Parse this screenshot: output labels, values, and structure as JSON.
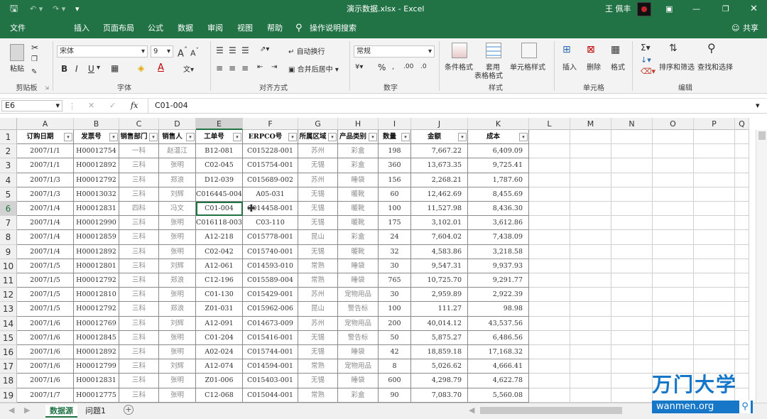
{
  "window": {
    "title": "演示数据.xlsx  -  Excel",
    "user": "王 佩丰"
  },
  "ribbon_tabs": [
    "文件",
    "插入",
    "页面布局",
    "公式",
    "数据",
    "审阅",
    "视图",
    "帮助"
  ],
  "tell_me": "操作说明搜索",
  "share": "共享",
  "font": {
    "name": "宋体",
    "size": "9",
    "bold": "B",
    "italic": "I",
    "underline": "U",
    "grow": "A",
    "shrink": "A"
  },
  "clipboard": {
    "paste": "粘贴"
  },
  "alignment": {
    "wrap": "自动换行",
    "merge": "合并后居中"
  },
  "number": {
    "format": "常规",
    "percent": "%"
  },
  "styles": {
    "cond": "条件格式",
    "table1": "套用",
    "table2": "表格格式",
    "cell": "单元格样式"
  },
  "cells": {
    "insert": "插入",
    "delete": "删除",
    "format": "格式"
  },
  "editing": {
    "sort": "排序和筛选",
    "find": "查找和选择"
  },
  "group_labels": {
    "clipboard": "剪贴板",
    "font": "字体",
    "alignment": "对齐方式",
    "number": "数字",
    "styles": "样式",
    "cells": "单元格",
    "editing": "编辑"
  },
  "name_box": "E6",
  "formula_value": "C01-004",
  "fx": "fx",
  "columns": [
    "A",
    "B",
    "C",
    "D",
    "E",
    "F",
    "G",
    "H",
    "I",
    "J",
    "K",
    "L",
    "M",
    "N",
    "O",
    "P",
    "Q"
  ],
  "row_numbers": [
    "1",
    "2",
    "3",
    "4",
    "5",
    "6",
    "7",
    "8",
    "9",
    "10",
    "11",
    "12",
    "13",
    "14",
    "15",
    "16",
    "17",
    "18",
    "19"
  ],
  "headers": [
    "订购日期",
    "发票号",
    "销售部门",
    "销售人",
    "工单号",
    "ERPCO号",
    "所属区域",
    "产品类别",
    "数量",
    "金额",
    "成本"
  ],
  "rows": [
    [
      "2007/1/1",
      "H00012754",
      "一科",
      "赵温江",
      "B12-081",
      "C015228-001",
      "苏州",
      "彩盒",
      "198",
      "7,667.22",
      "6,409.09"
    ],
    [
      "2007/1/1",
      "H00012892",
      "三科",
      "张明",
      "C02-045",
      "C015754-001",
      "无锡",
      "彩盒",
      "360",
      "13,673.35",
      "9,725.41"
    ],
    [
      "2007/1/3",
      "H00012792",
      "三科",
      "郑浪",
      "D12-039",
      "C015689-002",
      "苏州",
      "睡袋",
      "156",
      "2,268.21",
      "1,787.60"
    ],
    [
      "2007/1/3",
      "H00013032",
      "三科",
      "刘辉",
      "C016445-004",
      "A05-031",
      "无锡",
      "暖靴",
      "60",
      "12,462.69",
      "8,455.69"
    ],
    [
      "2007/1/4",
      "H00012831",
      "四科",
      "冯文",
      "C01-004",
      "C014458-001",
      "无锡",
      "暖靴",
      "100",
      "11,527.98",
      "8,436.30"
    ],
    [
      "2007/1/4",
      "H00012990",
      "三科",
      "张明",
      "C016118-003",
      "C03-110",
      "无锡",
      "暖靴",
      "175",
      "3,102.01",
      "3,612.86"
    ],
    [
      "2007/1/4",
      "H00012859",
      "三科",
      "张明",
      "A12-218",
      "C015778-001",
      "昆山",
      "彩盒",
      "24",
      "7,604.02",
      "7,438.09"
    ],
    [
      "2007/1/4",
      "H00012892",
      "三科",
      "张明",
      "C02-042",
      "C015740-001",
      "无锡",
      "暖靴",
      "32",
      "4,583.86",
      "3,218.58"
    ],
    [
      "2007/1/5",
      "H00012801",
      "三科",
      "刘辉",
      "A12-061",
      "C014593-010",
      "常熟",
      "睡袋",
      "30",
      "9,547.31",
      "9,937.93"
    ],
    [
      "2007/1/5",
      "H00012792",
      "三科",
      "郑浪",
      "C12-196",
      "C015589-004",
      "常熟",
      "睡袋",
      "765",
      "10,725.70",
      "9,291.77"
    ],
    [
      "2007/1/5",
      "H00012810",
      "三科",
      "张明",
      "C01-130",
      "C015429-001",
      "苏州",
      "宠物用品",
      "30",
      "2,959.89",
      "2,922.39"
    ],
    [
      "2007/1/5",
      "H00012792",
      "三科",
      "郑浪",
      "Z01-031",
      "C015962-006",
      "昆山",
      "警告标",
      "100",
      "111.27",
      "98.98"
    ],
    [
      "2007/1/6",
      "H00012769",
      "三科",
      "刘辉",
      "A12-091",
      "C014673-009",
      "苏州",
      "宠物用品",
      "200",
      "40,014.12",
      "43,537.56"
    ],
    [
      "2007/1/6",
      "H00012845",
      "三科",
      "张明",
      "C01-204",
      "C015416-001",
      "无锡",
      "警告标",
      "50",
      "5,875.27",
      "6,486.56"
    ],
    [
      "2007/1/6",
      "H00012892",
      "三科",
      "张明",
      "A02-024",
      "C015744-001",
      "无锡",
      "睡袋",
      "42",
      "18,859.18",
      "17,168.32"
    ],
    [
      "2007/1/6",
      "H00012799",
      "三科",
      "刘辉",
      "A12-074",
      "C014594-001",
      "常熟",
      "宠物用品",
      "8",
      "5,026.62",
      "4,666.41"
    ],
    [
      "2007/1/6",
      "H00012831",
      "三科",
      "张明",
      "Z01-006",
      "C015403-001",
      "无锡",
      "睡袋",
      "600",
      "4,298.79",
      "4,622.78"
    ],
    [
      "2007/1/7",
      "H00012775",
      "三科",
      "张明",
      "C12-068",
      "C015044-001",
      "常熟",
      "彩盒",
      "90",
      "7,083.70",
      "5,560.08"
    ]
  ],
  "sheets": [
    "数据源",
    "问题1"
  ],
  "watermark": {
    "brand": "万门大学",
    "url": "wanmen.org"
  }
}
